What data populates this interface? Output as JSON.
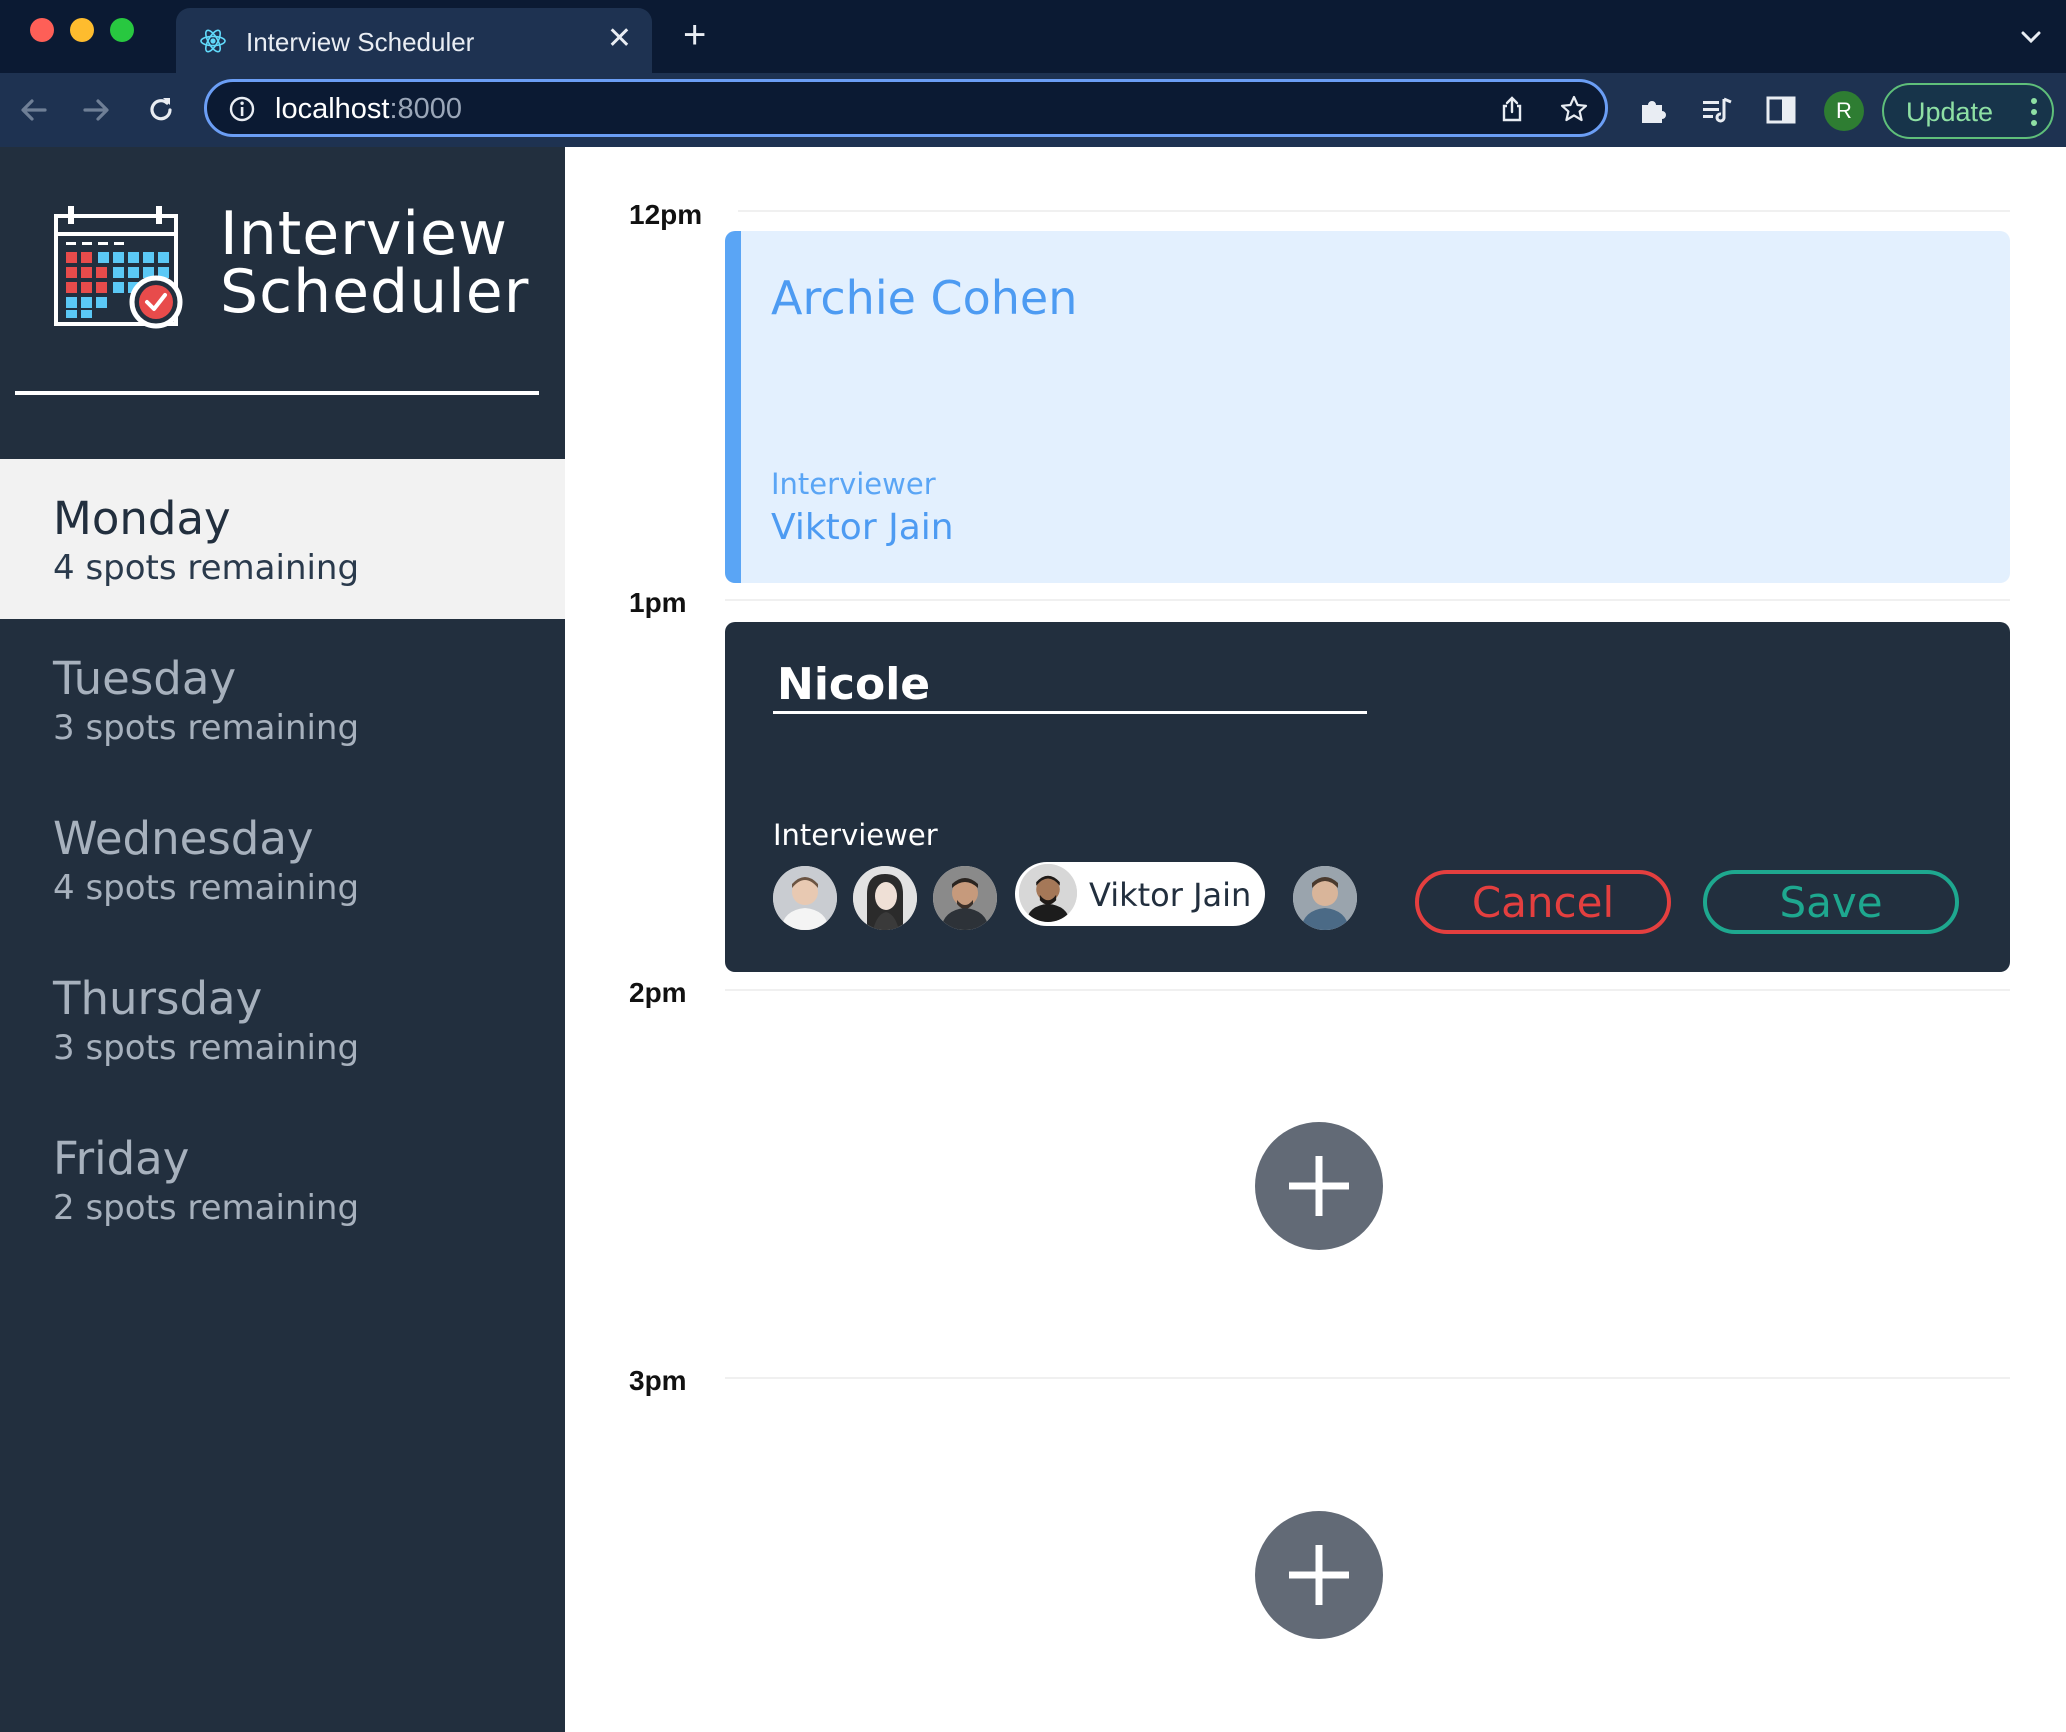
{
  "browser": {
    "tab_title": "Interview Scheduler",
    "url_host": "localhost",
    "url_port": ":8000",
    "profile_initial": "R",
    "update_label": "Update"
  },
  "sidebar": {
    "logo_line1": "Interview",
    "logo_line2": "Scheduler",
    "days": [
      {
        "name": "Monday",
        "spots": "4 spots remaining",
        "selected": true
      },
      {
        "name": "Tuesday",
        "spots": "3 spots remaining",
        "selected": false
      },
      {
        "name": "Wednesday",
        "spots": "4 spots remaining",
        "selected": false
      },
      {
        "name": "Thursday",
        "spots": "3 spots remaining",
        "selected": false
      },
      {
        "name": "Friday",
        "spots": "2 spots remaining",
        "selected": false
      }
    ]
  },
  "schedule": {
    "times": [
      "12pm",
      "1pm",
      "2pm",
      "3pm"
    ],
    "appointment": {
      "student": "Archie Cohen",
      "interviewer_label": "Interviewer",
      "interviewer": "Viktor Jain"
    },
    "form": {
      "student_value": "Nicole",
      "interviewer_label": "Interviewer",
      "selected_interviewer": "Viktor Jain",
      "cancel_label": "Cancel",
      "save_label": "Save"
    }
  },
  "colors": {
    "sidebar_bg": "#222f3e",
    "show_bg": "#e3f0fe",
    "show_accent": "#5aa5f5",
    "cancel": "#e43f3f",
    "save": "#1ea88f",
    "add_button": "#626a76"
  }
}
